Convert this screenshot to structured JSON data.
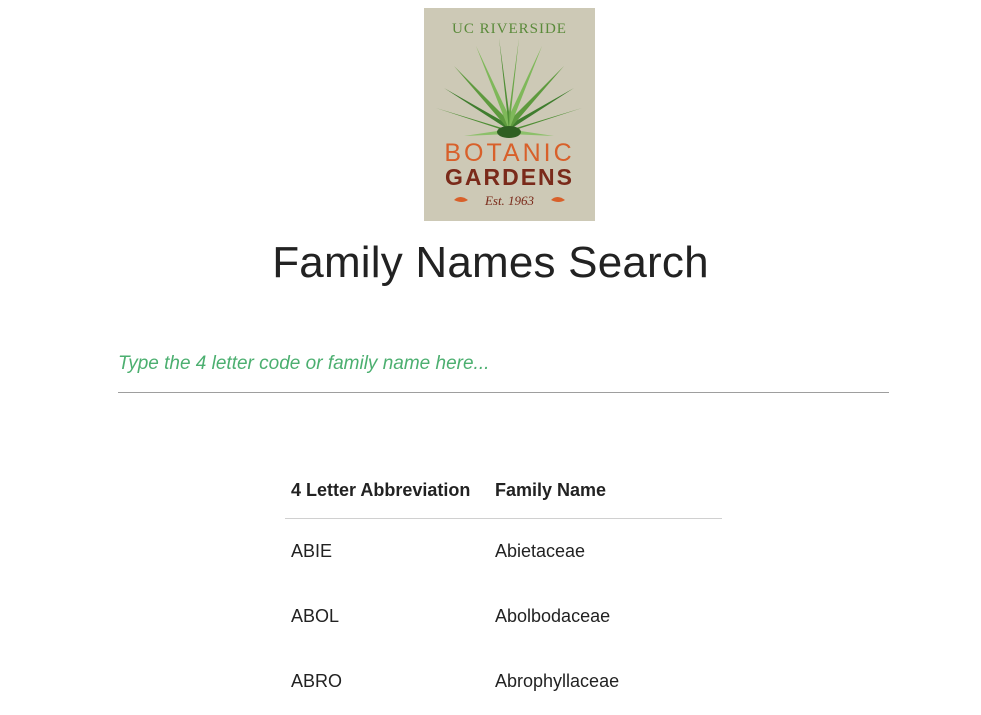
{
  "logo": {
    "top_text": "UC RIVERSIDE",
    "line1": "BOTANIC",
    "line2": "GARDENS",
    "est": "Est. 1963",
    "colors": {
      "background": "#cdc9b6",
      "top_text": "#5a8a3a",
      "botanic": "#d8602a",
      "gardens": "#7a2a1a",
      "leaf_dark": "#3f7d2e",
      "leaf_light": "#7fb85a"
    }
  },
  "page": {
    "title": "Family Names Search"
  },
  "search": {
    "placeholder": "Type the 4 letter code or family name here...",
    "value": ""
  },
  "table": {
    "headers": [
      "4 Letter Abbreviation",
      "Family Name"
    ],
    "rows": [
      [
        "ABIE",
        "Abietaceae"
      ],
      [
        "ABOL",
        "Abolbodaceae"
      ],
      [
        "ABRO",
        "Abrophyllaceae"
      ]
    ]
  },
  "colors": {
    "placeholder": "#4caf70",
    "divider": "#9e9e9e",
    "text": "#222222"
  }
}
